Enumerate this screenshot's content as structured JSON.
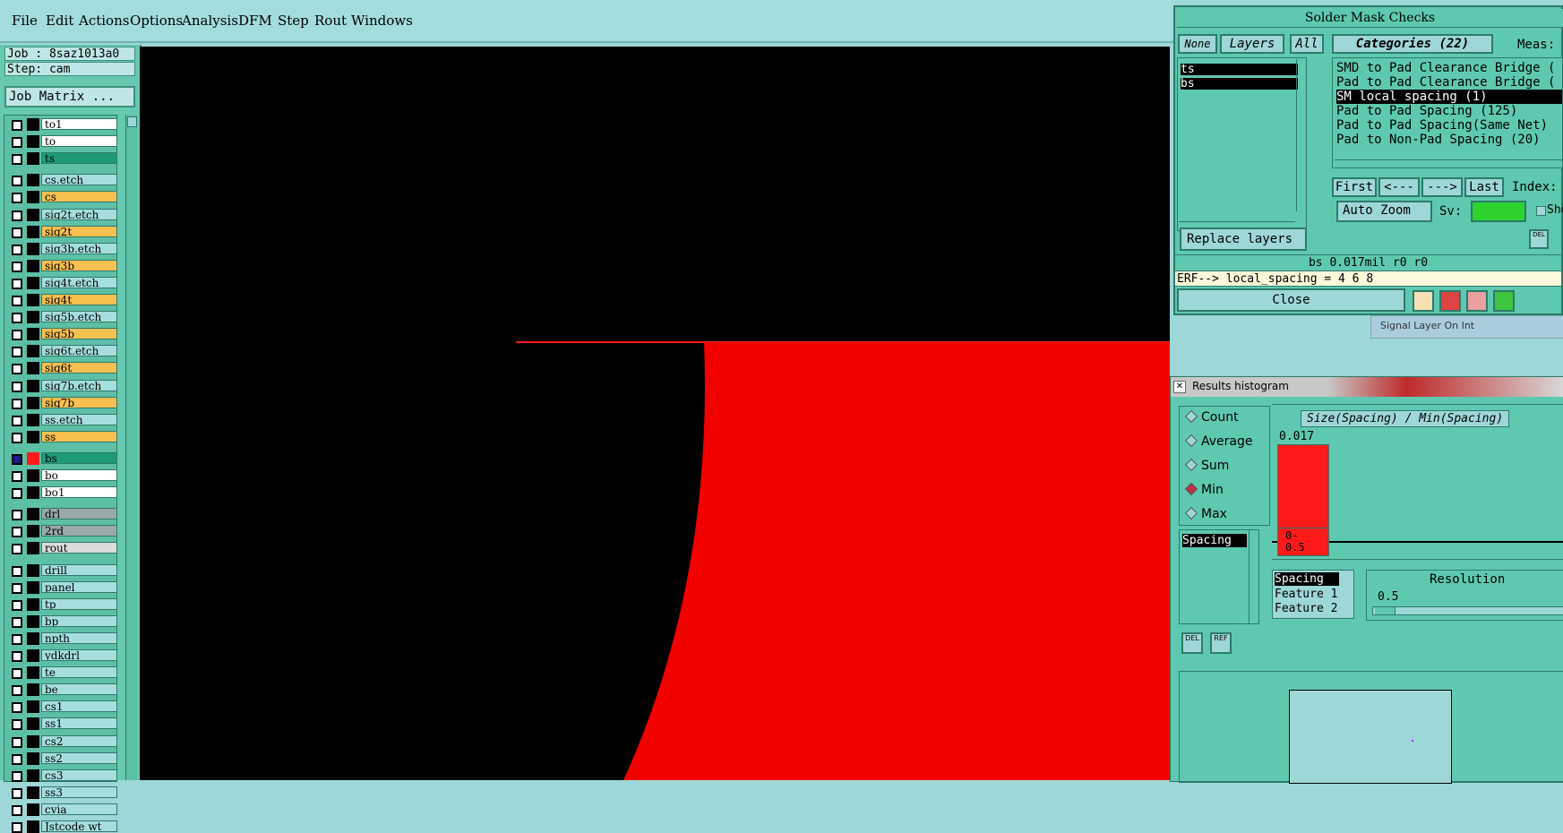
{
  "menubar": {
    "items": [
      "File",
      "Edit",
      "Actions",
      "Options",
      "Analysis",
      "DFM",
      "Step",
      "Rout",
      "Windows"
    ]
  },
  "leftpanel": {
    "job": "Job : 8saz1013a0",
    "step": "Step: cam",
    "job_matrix_label": "Job Matrix ...",
    "layers": [
      {
        "name": "to1",
        "color": "#ffffff"
      },
      {
        "name": "to",
        "color": "#ffffff"
      },
      {
        "name": "ts",
        "color": "#1e9a7a"
      },
      {
        "name": "cs.etch",
        "color": "#a6dede"
      },
      {
        "name": "cs",
        "color": "#f8c050"
      },
      {
        "name": "sig2t.etch",
        "color": "#a6dede"
      },
      {
        "name": "sig2t",
        "color": "#f8c050"
      },
      {
        "name": "sig3b.etch",
        "color": "#a6dede"
      },
      {
        "name": "sig3b",
        "color": "#f8c050"
      },
      {
        "name": "sig4t.etch",
        "color": "#a6dede"
      },
      {
        "name": "sig4t",
        "color": "#f8c050"
      },
      {
        "name": "sig5b.etch",
        "color": "#a6dede"
      },
      {
        "name": "sig5b",
        "color": "#f8c050"
      },
      {
        "name": "sig6t.etch",
        "color": "#a6dede"
      },
      {
        "name": "sig6t",
        "color": "#f8c050"
      },
      {
        "name": "sig7b.etch",
        "color": "#a6dede"
      },
      {
        "name": "sig7b",
        "color": "#f8c050"
      },
      {
        "name": "ss.etch",
        "color": "#a6dede"
      },
      {
        "name": "ss",
        "color": "#f8c050"
      },
      {
        "name": "bs",
        "color": "#1e9a7a"
      },
      {
        "name": "bo",
        "color": "#ffffff"
      },
      {
        "name": "bo1",
        "color": "#ffffff"
      },
      {
        "name": "drl",
        "color": "#9aa9ad"
      },
      {
        "name": "2rd",
        "color": "#9aa9ad"
      },
      {
        "name": "rout",
        "color": "#dcdcdc"
      },
      {
        "name": "drill",
        "color": "#a6dede"
      },
      {
        "name": "panel",
        "color": "#a6dede"
      },
      {
        "name": "tp",
        "color": "#a6dede"
      },
      {
        "name": "bp",
        "color": "#a6dede"
      },
      {
        "name": "npth",
        "color": "#a6dede"
      },
      {
        "name": "ydkdrl",
        "color": "#a6dede"
      },
      {
        "name": "te",
        "color": "#a6dede"
      },
      {
        "name": "be",
        "color": "#a6dede"
      },
      {
        "name": "cs1",
        "color": "#a6dede"
      },
      {
        "name": "ss1",
        "color": "#a6dede"
      },
      {
        "name": "cs2",
        "color": "#a6dede"
      },
      {
        "name": "ss2",
        "color": "#a6dede"
      },
      {
        "name": "cs3",
        "color": "#a6dede"
      },
      {
        "name": "ss3",
        "color": "#a6dede"
      },
      {
        "name": "cvia",
        "color": "#a6dede"
      },
      {
        "name": "Jstcode wt",
        "color": "#a6dede"
      }
    ]
  },
  "solder": {
    "title": "Solder Mask Checks",
    "none_label": "None",
    "layers_label": "Layers",
    "all_label": "All",
    "categories_label": "Categories (22)",
    "meas_label": "Meas:",
    "layer_items": [
      "ts",
      "bs"
    ],
    "categories": [
      "SMD to Pad Clearance Bridge (",
      "Pad to Pad Clearance Bridge (",
      "SM local spacing (1)",
      "Pad to Pad Spacing (125)",
      "Pad to Pad Spacing(Same Net)",
      "Pad to Non-Pad Spacing (20)"
    ],
    "first_label": "First",
    "prev_label": "<---",
    "next_label": "--->",
    "last_label": "Last",
    "index_label": "Index:",
    "auto_zoom_label": "Auto Zoom",
    "sv_label": "Sv:",
    "show_label": "Sho",
    "replace_layers_label": "Replace layers",
    "status_text": "bs 0.017mil  r0  r0",
    "erf_text": "ERF--> local_spacing = 4 6 8",
    "close_label": "Close",
    "background_hint": "Signal Layer On Int"
  },
  "histogram": {
    "title": "Results histogram",
    "modes": [
      "Count",
      "Average",
      "Sum",
      "Min",
      "Max"
    ],
    "selected_mode": "Min",
    "spacing_item": "Spacing",
    "chart_title": "Size(Spacing) / Min(Spacing)",
    "bar_value_label": "0.017",
    "bin_label": "0-\n0.5",
    "list_items": [
      "Spacing",
      "Feature 1",
      "Feature 2"
    ],
    "resolution_label": "Resolution",
    "resolution_value": "0.5",
    "del_label": "DEL",
    "ref_label": "REF"
  },
  "colors": {
    "accent_red": "#ff1a1a",
    "panel": "#5ec9b0",
    "light": "#9ed7d7",
    "black": "#000000"
  }
}
